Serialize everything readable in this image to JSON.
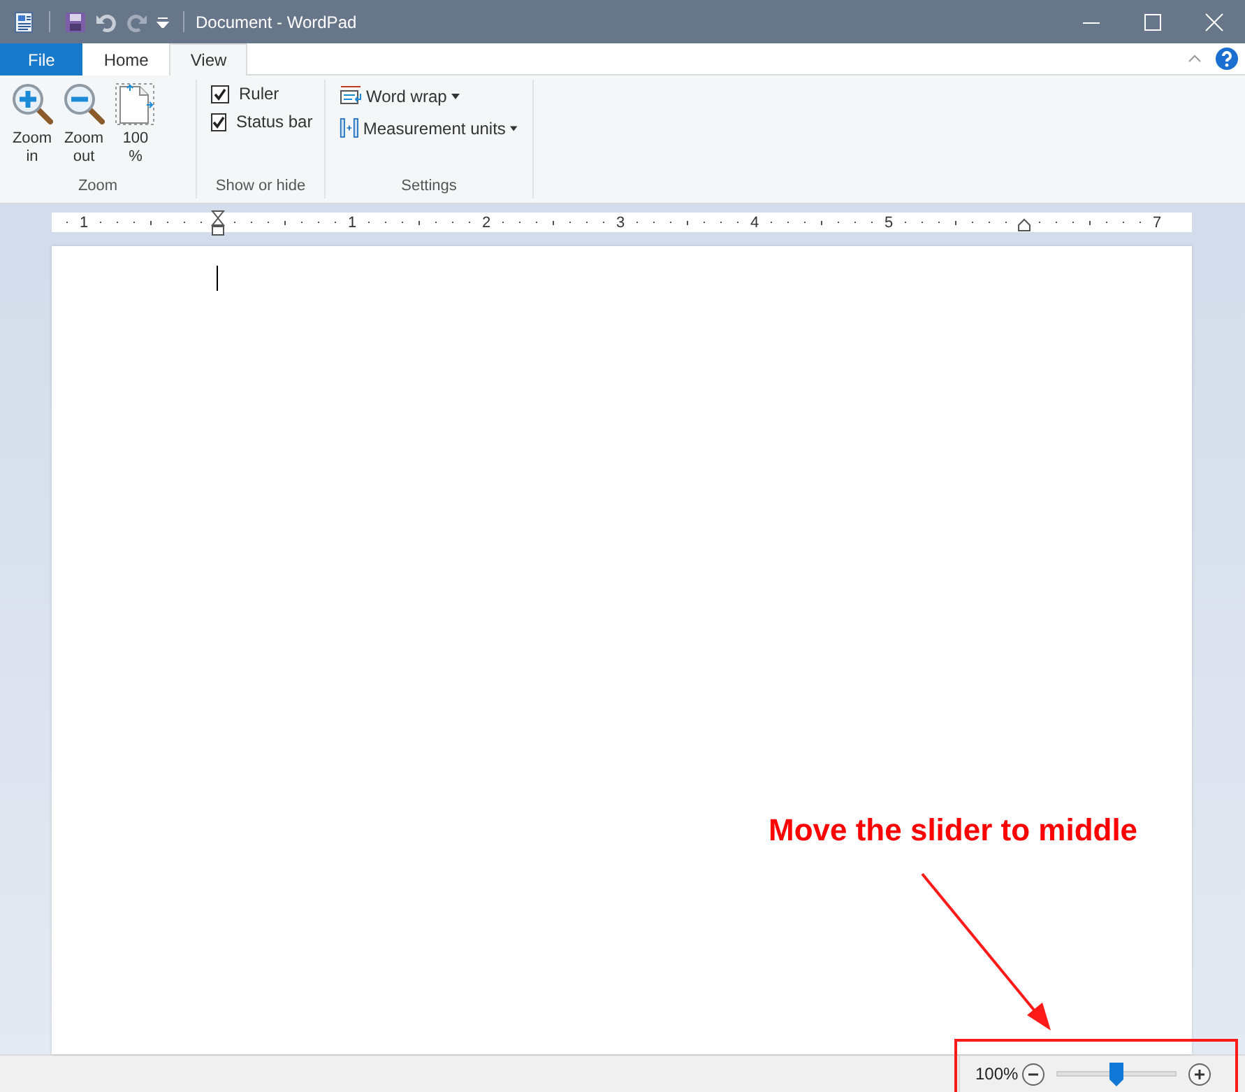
{
  "window": {
    "title": "Document - WordPad"
  },
  "tabs": [
    {
      "label": "File",
      "kind": "file",
      "selected": false
    },
    {
      "label": "Home",
      "kind": "tab",
      "selected": false
    },
    {
      "label": "View",
      "kind": "tab",
      "selected": true
    }
  ],
  "zoom_group": {
    "label": "Zoom",
    "buttons": [
      "Zoom in",
      "Zoom out",
      "100 %"
    ]
  },
  "show_group": {
    "label": "Show or hide",
    "options": [
      {
        "label": "Ruler",
        "checked": true
      },
      {
        "label": "Status bar",
        "checked": true
      }
    ]
  },
  "settings_group": {
    "label": "Settings",
    "buttons": [
      "Word wrap",
      "Measurement units"
    ]
  },
  "ruler": {
    "labels": [
      "1",
      "1",
      "2",
      "3",
      "4",
      "5",
      "7"
    ]
  },
  "status_bar": {
    "zoom": "100%",
    "slider": {
      "level": 0.5
    }
  },
  "annotation": {
    "text": "Move the slider to middle"
  }
}
